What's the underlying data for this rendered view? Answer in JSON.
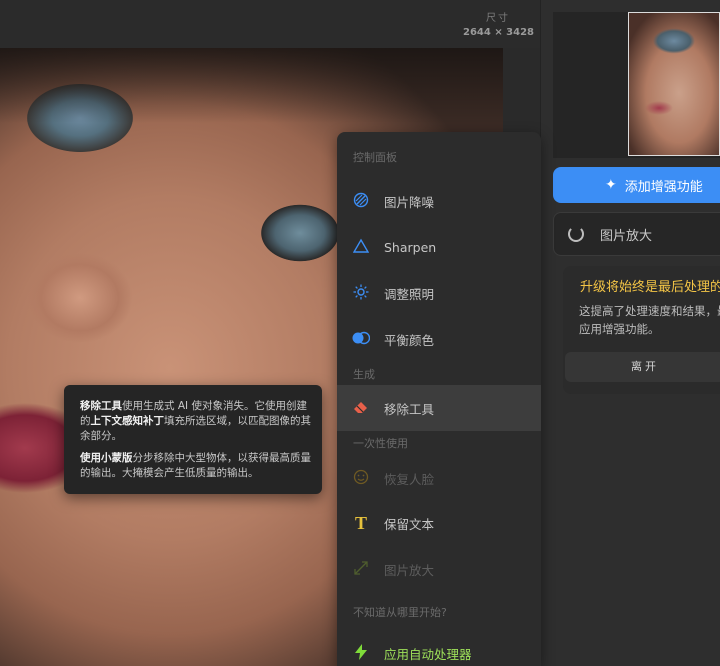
{
  "size_label": "尺寸",
  "size_value": "2644 × 3428",
  "control_panel": {
    "section_control": "控制面板",
    "items_control": [
      {
        "label": "图片降噪",
        "icon": "denoise-icon"
      },
      {
        "label": "Sharpen",
        "icon": "sharpen-icon"
      },
      {
        "label": "调整照明",
        "icon": "lighting-icon"
      },
      {
        "label": "平衡颜色",
        "icon": "color-balance-icon"
      }
    ],
    "section_generate": "生成",
    "remove_tool": "移除工具",
    "section_one_time": "一次性使用",
    "restore_face": "恢复人脸",
    "keep_text": "保留文本",
    "image_upscale": "图片放大",
    "section_start": "不知道从哪里开始?",
    "auto_processor": "应用自动处理器"
  },
  "tooltip": {
    "p1_bold1": "移除工具",
    "p1_text1": "使用生成式 AI 使对象消失。它使用创建的",
    "p1_bold2": "上下文感知补丁",
    "p1_text2": "填充所选区域，以匹配图像的其余部分。",
    "p2_text1": "使用",
    "p2_bold1": "小蒙版",
    "p2_text2": "分步移除中大型物体，以获得最高质量的输出。大掩模会产生低质量的输出。"
  },
  "sidebar": {
    "enhance_button": "添加增强功能",
    "upscale_button": "图片放大",
    "upgrade_title": "升级将始终是最后处理的",
    "upgrade_desc": "这提高了处理速度和结果，最后应用增强功能。",
    "leave_button": "离开"
  },
  "colors": {
    "accent": "#3c8ef5",
    "warning": "#f3c446",
    "remove_tool": "#e8604a",
    "auto": "#7fdc3a"
  }
}
